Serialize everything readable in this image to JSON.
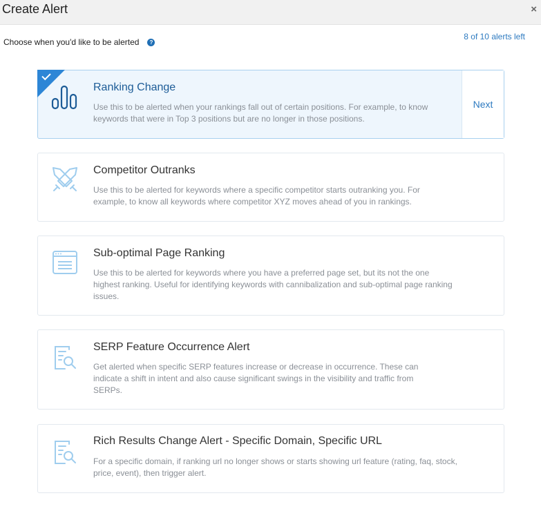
{
  "dialog": {
    "title": "Create Alert",
    "close_label": "×"
  },
  "subtitle": "Choose when you'd like to be alerted",
  "help_label": "?",
  "alerts_left": "8 of 10 alerts left",
  "colors": {
    "accent": "#2d86d6",
    "link": "#2d7ac0",
    "selected_bg": "#eef6fd"
  },
  "alerts": [
    {
      "title": "Ranking Change",
      "description": "Use this to be alerted when your rankings fall out of certain positions. For example, to know keywords that were in Top 3 positions but are no longer in those positions.",
      "icon": "bar-chart-icon",
      "selected": true,
      "next_label": "Next"
    },
    {
      "title": "Competitor Outranks",
      "description": "Use this to be alerted for keywords where a specific competitor starts outranking you. For example, to know all keywords where competitor XYZ moves ahead of you in rankings.",
      "icon": "crossed-swords-icon"
    },
    {
      "title": "Sub-optimal Page Ranking",
      "description": "Use this to be alerted for keywords where you have a preferred page set, but its not the one highest ranking. Useful for identifying keywords with cannibalization and sub-optimal page ranking issues.",
      "icon": "browser-page-icon"
    },
    {
      "title": "SERP Feature Occurrence Alert",
      "description": "Get alerted when specific SERP features increase or decrease in occurrence. These can indicate a shift in intent and also cause significant swings in the visibility and traffic from SERPs.",
      "icon": "document-search-icon"
    },
    {
      "title": "Rich Results Change Alert - Specific Domain, Specific URL",
      "description": "For a specific domain, if ranking url no longer shows or starts showing url feature (rating, faq, stock, price, event), then trigger alert.",
      "icon": "document-search-icon"
    }
  ]
}
